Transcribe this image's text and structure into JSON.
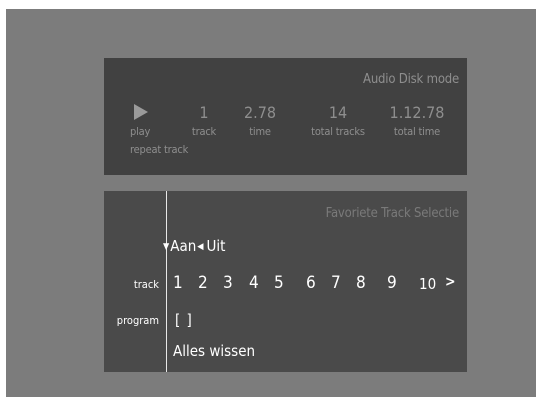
{
  "status_panel": {
    "mode_title": "Audio Disk mode",
    "play_label": "play",
    "track_value": "1",
    "track_label": "track",
    "time_value": "2.78",
    "time_label": "time",
    "total_tracks_value": "14",
    "total_tracks_label": "total tracks",
    "total_time_value": "1.12.78",
    "total_time_label": "total time",
    "repeat_label": "repeat track",
    "icons": {
      "play": "play-icon"
    }
  },
  "favorites_panel": {
    "title": "Favoriete Track Selectie",
    "on_label": "Aan",
    "off_label": "Uit",
    "track_row_label": "track",
    "program_row_label": "program",
    "tracks": [
      "1",
      "2",
      "3",
      "4",
      "5",
      "6",
      "7",
      "8",
      "9",
      "10"
    ],
    "more_symbol": ">",
    "program_value": "[ ]",
    "song_title": "Alles wissen",
    "icons": {
      "on_marker": "triangle-down-icon",
      "off_marker": "triangle-left-icon",
      "more": "chevron-right-icon"
    }
  },
  "colors": {
    "outer_background": "#7c7c7c",
    "status_panel_bg": "#414141",
    "favorites_panel_bg": "#4a4a4a",
    "dim_text": "#8e8e8e",
    "bright_text": "#ffffff"
  }
}
